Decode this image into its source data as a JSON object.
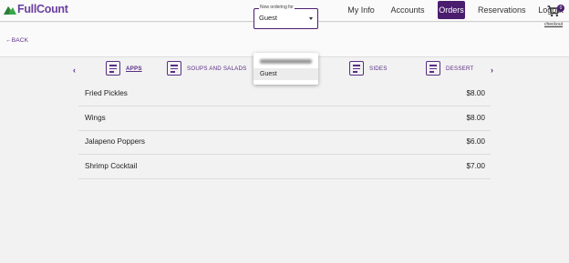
{
  "brand": {
    "name": "FullCount"
  },
  "nav": [
    {
      "label": "My Info",
      "active": false
    },
    {
      "label": "Accounts",
      "active": false
    },
    {
      "label": "Orders",
      "active": true
    },
    {
      "label": "Reservations",
      "active": false
    },
    {
      "label": "Logout",
      "active": false
    }
  ],
  "back_label": "←BACK",
  "order_for": {
    "legend": "Now ordering for",
    "value": "Guest",
    "options": [
      "Guest"
    ]
  },
  "cart": {
    "count": "0",
    "checkout_label": "checkout"
  },
  "categories": [
    {
      "label": "APPS",
      "active": true
    },
    {
      "label": "SOUPS AND SALADS",
      "active": false
    },
    {
      "label": "SIDES",
      "active": false
    },
    {
      "label": "DESSERT",
      "active": false
    }
  ],
  "items": [
    {
      "name": "Fried Pickles",
      "price": "$8.00"
    },
    {
      "name": "Wings",
      "price": "$8.00"
    },
    {
      "name": "Jalapeno Poppers",
      "price": "$6.00"
    },
    {
      "name": "Shrimp Cocktail",
      "price": "$7.00"
    }
  ],
  "colors": {
    "accent": "#4a1d6e",
    "link": "#5a2d86",
    "logo_green": "#3aa84a"
  }
}
